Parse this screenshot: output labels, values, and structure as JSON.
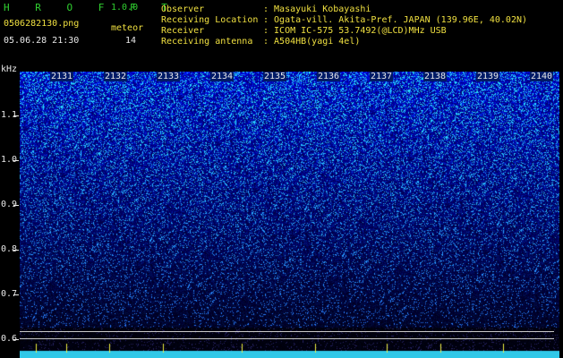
{
  "header": {
    "app_title": "H R O F F T",
    "version": "1.0.0",
    "filename": "0506282130.png",
    "meteor_label": "meteor",
    "datetime": "05.06.28 21:30",
    "meteor_count": "14"
  },
  "info": {
    "observer_label": "Observer",
    "observer_value": ": Masayuki Kobayashi",
    "location_label": "Receiving Location",
    "location_value": ": Ogata-vill. Akita-Pref. JAPAN (139.96E, 40.02N)",
    "receiver_label": "Receiver",
    "receiver_value": ": ICOM IC-575 53.7492(@LCD)MHz USB",
    "antenna_label": "Receiving antenna",
    "antenna_value": ": A504HB(yagi 4el)"
  },
  "axis": {
    "y_unit": "kHz",
    "y_ticks": [
      "1.1",
      "1.0",
      "0.9",
      "0.8",
      "0.7",
      "0.6"
    ],
    "x_ticks": [
      "2131",
      "2132",
      "2133",
      "2134",
      "2135",
      "2136",
      "2137",
      "2138",
      "2139",
      "2140"
    ]
  },
  "colors": {
    "background": "#000000",
    "title": "#30d030",
    "labels": "#f0e040",
    "noise_low": "#000a40",
    "noise_high": "#40e0ff"
  }
}
